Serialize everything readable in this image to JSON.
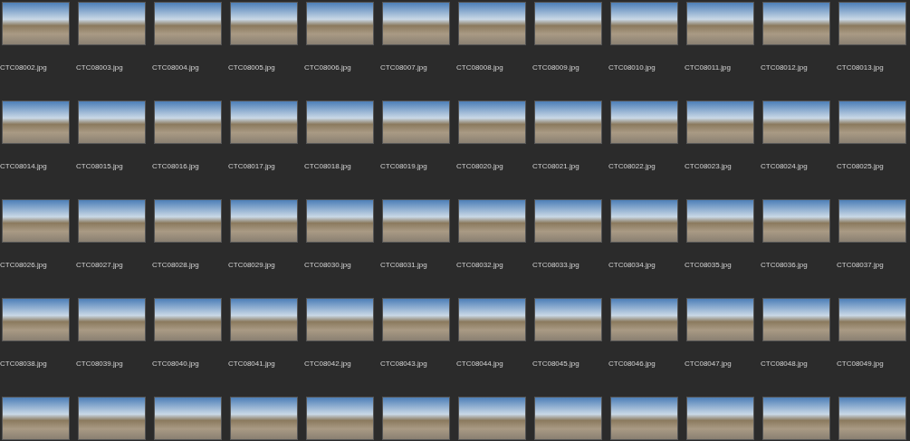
{
  "thumbnails": [
    {
      "kind": "labeled",
      "filename": "CTC08002.jpg"
    },
    {
      "kind": "labeled",
      "filename": "CTC08003.jpg"
    },
    {
      "kind": "labeled",
      "filename": "CTC08004.jpg"
    },
    {
      "kind": "labeled",
      "filename": "CTC08005.jpg"
    },
    {
      "kind": "labeled",
      "filename": "CTC08006.jpg"
    },
    {
      "kind": "labeled",
      "filename": "CTC08007.jpg"
    },
    {
      "kind": "labeled",
      "filename": "CTC08008.jpg"
    },
    {
      "kind": "labeled",
      "filename": "CTC08009.jpg"
    },
    {
      "kind": "labeled",
      "filename": "CTC08010.jpg"
    },
    {
      "kind": "labeled",
      "filename": "CTC08011.jpg"
    },
    {
      "kind": "labeled",
      "filename": "CTC08012.jpg"
    },
    {
      "kind": "labeled",
      "filename": "CTC08013.jpg"
    },
    {
      "kind": "labeled",
      "filename": "CTC08014.jpg"
    },
    {
      "kind": "labeled",
      "filename": "CTC08015.jpg"
    },
    {
      "kind": "labeled",
      "filename": "CTC08016.jpg"
    },
    {
      "kind": "labeled",
      "filename": "CTC08017.jpg"
    },
    {
      "kind": "labeled",
      "filename": "CTC08018.jpg"
    },
    {
      "kind": "labeled",
      "filename": "CTC08019.jpg"
    },
    {
      "kind": "labeled",
      "filename": "CTC08020.jpg"
    },
    {
      "kind": "labeled",
      "filename": "CTC08021.jpg"
    },
    {
      "kind": "labeled",
      "filename": "CTC08022.jpg"
    },
    {
      "kind": "labeled",
      "filename": "CTC08023.jpg"
    },
    {
      "kind": "labeled",
      "filename": "CTC08024.jpg"
    },
    {
      "kind": "labeled",
      "filename": "CTC08025.jpg"
    },
    {
      "kind": "labeled",
      "filename": "CTC08026.jpg"
    },
    {
      "kind": "labeled",
      "filename": "CTC08027.jpg"
    },
    {
      "kind": "labeled",
      "filename": "CTC08028.jpg"
    },
    {
      "kind": "labeled",
      "filename": "CTC08029.jpg"
    },
    {
      "kind": "labeled",
      "filename": "CTC08030.jpg"
    },
    {
      "kind": "labeled",
      "filename": "CTC08031.jpg"
    },
    {
      "kind": "labeled",
      "filename": "CTC08032.jpg"
    },
    {
      "kind": "labeled",
      "filename": "CTC08033.jpg"
    },
    {
      "kind": "labeled",
      "filename": "CTC08034.jpg"
    },
    {
      "kind": "labeled",
      "filename": "CTC08035.jpg"
    },
    {
      "kind": "labeled",
      "filename": "CTC08036.jpg"
    },
    {
      "kind": "labeled",
      "filename": "CTC08037.jpg"
    },
    {
      "kind": "labeled",
      "filename": "CTC08038.jpg"
    },
    {
      "kind": "labeled",
      "filename": "CTC08039.jpg"
    },
    {
      "kind": "labeled",
      "filename": "CTC08040.jpg"
    },
    {
      "kind": "labeled",
      "filename": "CTC08041.jpg"
    },
    {
      "kind": "labeled",
      "filename": "CTC08042.jpg"
    },
    {
      "kind": "labeled",
      "filename": "CTC08043.jpg"
    },
    {
      "kind": "labeled",
      "filename": "CTC08044.jpg"
    },
    {
      "kind": "labeled",
      "filename": "CTC08045.jpg"
    },
    {
      "kind": "labeled",
      "filename": "CTC08046.jpg"
    },
    {
      "kind": "labeled",
      "filename": "CTC08047.jpg"
    },
    {
      "kind": "labeled",
      "filename": "CTC08048.jpg"
    },
    {
      "kind": "labeled",
      "filename": "CTC08049.jpg"
    },
    {
      "kind": "unlabeled"
    },
    {
      "kind": "unlabeled"
    },
    {
      "kind": "unlabeled"
    },
    {
      "kind": "unlabeled"
    },
    {
      "kind": "unlabeled"
    },
    {
      "kind": "unlabeled"
    },
    {
      "kind": "unlabeled"
    },
    {
      "kind": "unlabeled"
    },
    {
      "kind": "unlabeled"
    },
    {
      "kind": "unlabeled"
    },
    {
      "kind": "unlabeled"
    },
    {
      "kind": "unlabeled"
    }
  ]
}
